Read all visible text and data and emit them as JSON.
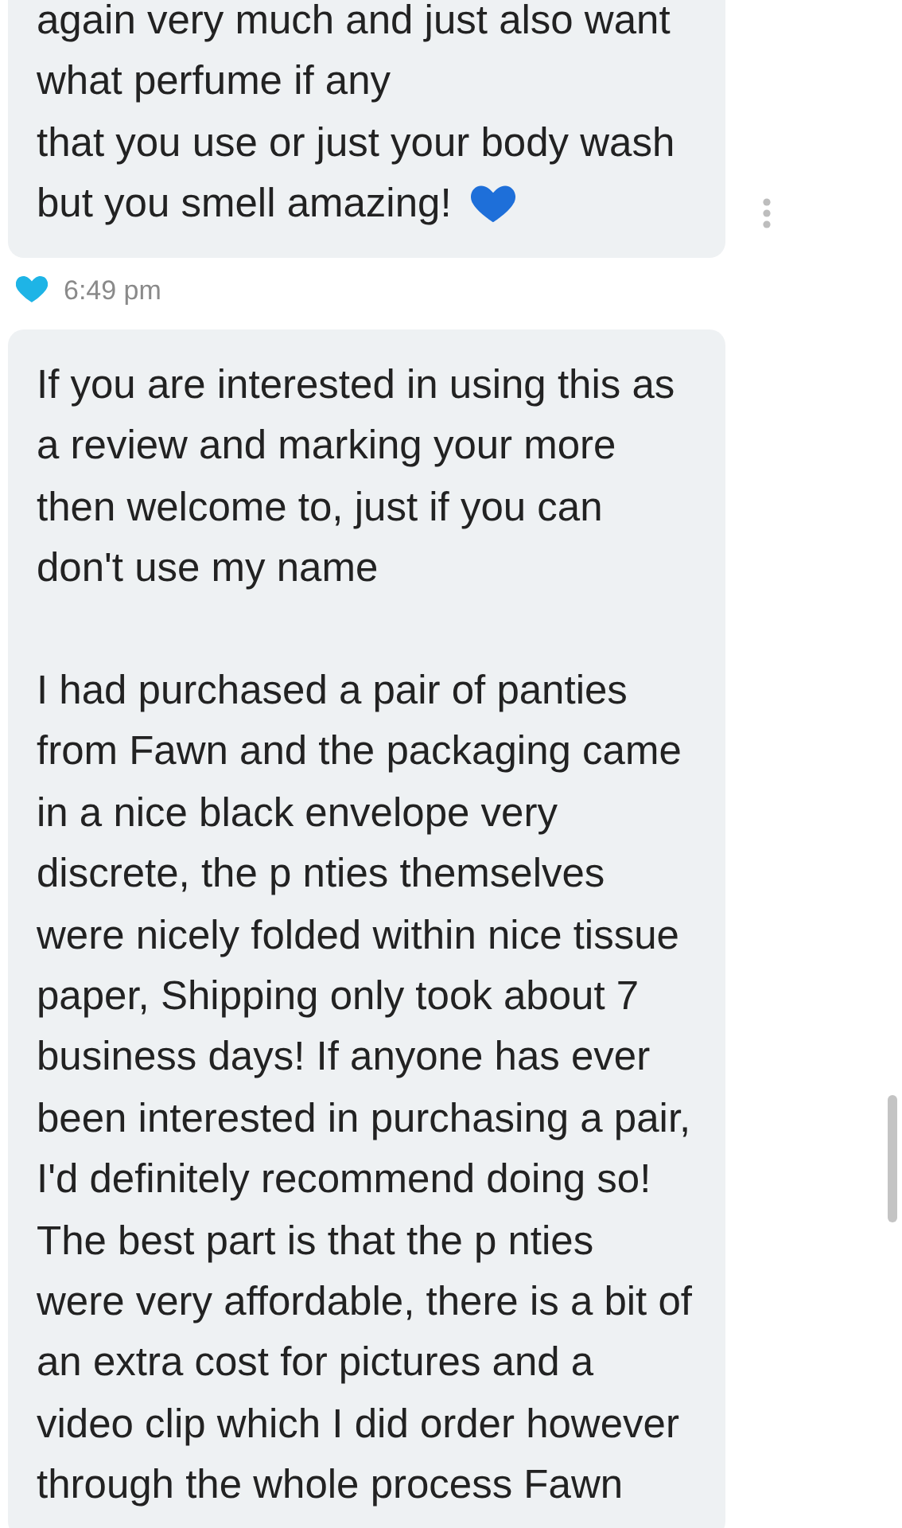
{
  "messages": [
    {
      "paragraphs": [
        [
          "again very much and just also want",
          "what perfume if any",
          "that you use or just your body wash",
          "but you smell amazing!"
        ]
      ],
      "heart_emoji": true,
      "liked": true,
      "time": "6:49 pm",
      "menu": true
    },
    {
      "paragraphs": [
        [
          "If you are interested in using this as",
          "a review and marking your more",
          "then welcome to, just if you can",
          "don't use my name"
        ],
        [
          "I had purchased a pair of panties",
          "from Fawn and the packaging came",
          "in a nice black envelope very",
          "discrete, the p nties themselves",
          "were nicely folded within nice tissue",
          "paper, Shipping only took about 7",
          "business days! If anyone has ever",
          "been interested in purchasing a pair,",
          "I'd definitely recommend doing so!",
          "The best part is that the p nties",
          "were very affordable, there is a bit of",
          "an extra cost for pictures and a",
          "video clip which I did order however",
          "through the whole process Fawn"
        ]
      ],
      "heart_emoji": false,
      "liked": false,
      "menu": false
    }
  ]
}
